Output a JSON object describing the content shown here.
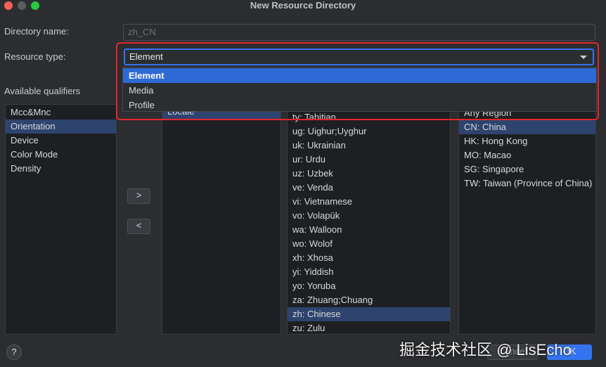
{
  "window": {
    "title": "New Resource Directory"
  },
  "form": {
    "directory_name_label": "Directory name:",
    "directory_name_value": "zh_CN",
    "resource_type_label": "Resource type:",
    "resource_type_value": "Element",
    "available_qualifiers_label": "Available qualifiers"
  },
  "resource_type_options": [
    "Element",
    "Media",
    "Profile"
  ],
  "qualifiers": [
    "Mcc&Mnc",
    "Orientation",
    "Device",
    "Color Mode",
    "Density"
  ],
  "chosen_qualifiers": [
    "Locale"
  ],
  "buttons": {
    "add": ">",
    "remove": "<",
    "help": "?",
    "cancel": "Cancel",
    "ok": "OK"
  },
  "languages": [
    "ty: Tahitian",
    "ug: Uighur;Uyghur",
    "uk: Ukrainian",
    "ur: Urdu",
    "uz: Uzbek",
    "ve: Venda",
    "vi: Vietnamese",
    "vo: Volapük",
    "wa: Walloon",
    "wo: Wolof",
    "xh: Xhosa",
    "yi: Yiddish",
    "yo: Yoruba",
    "za: Zhuang;Chuang",
    "zh: Chinese",
    "zu: Zulu"
  ],
  "regions": [
    "Any Region",
    "CN: China",
    "HK: Hong Kong",
    "MO: Macao",
    "SG: Singapore",
    "TW: Taiwan (Province of China)"
  ],
  "watermark": "掘金技术社区 @ LisEcho"
}
